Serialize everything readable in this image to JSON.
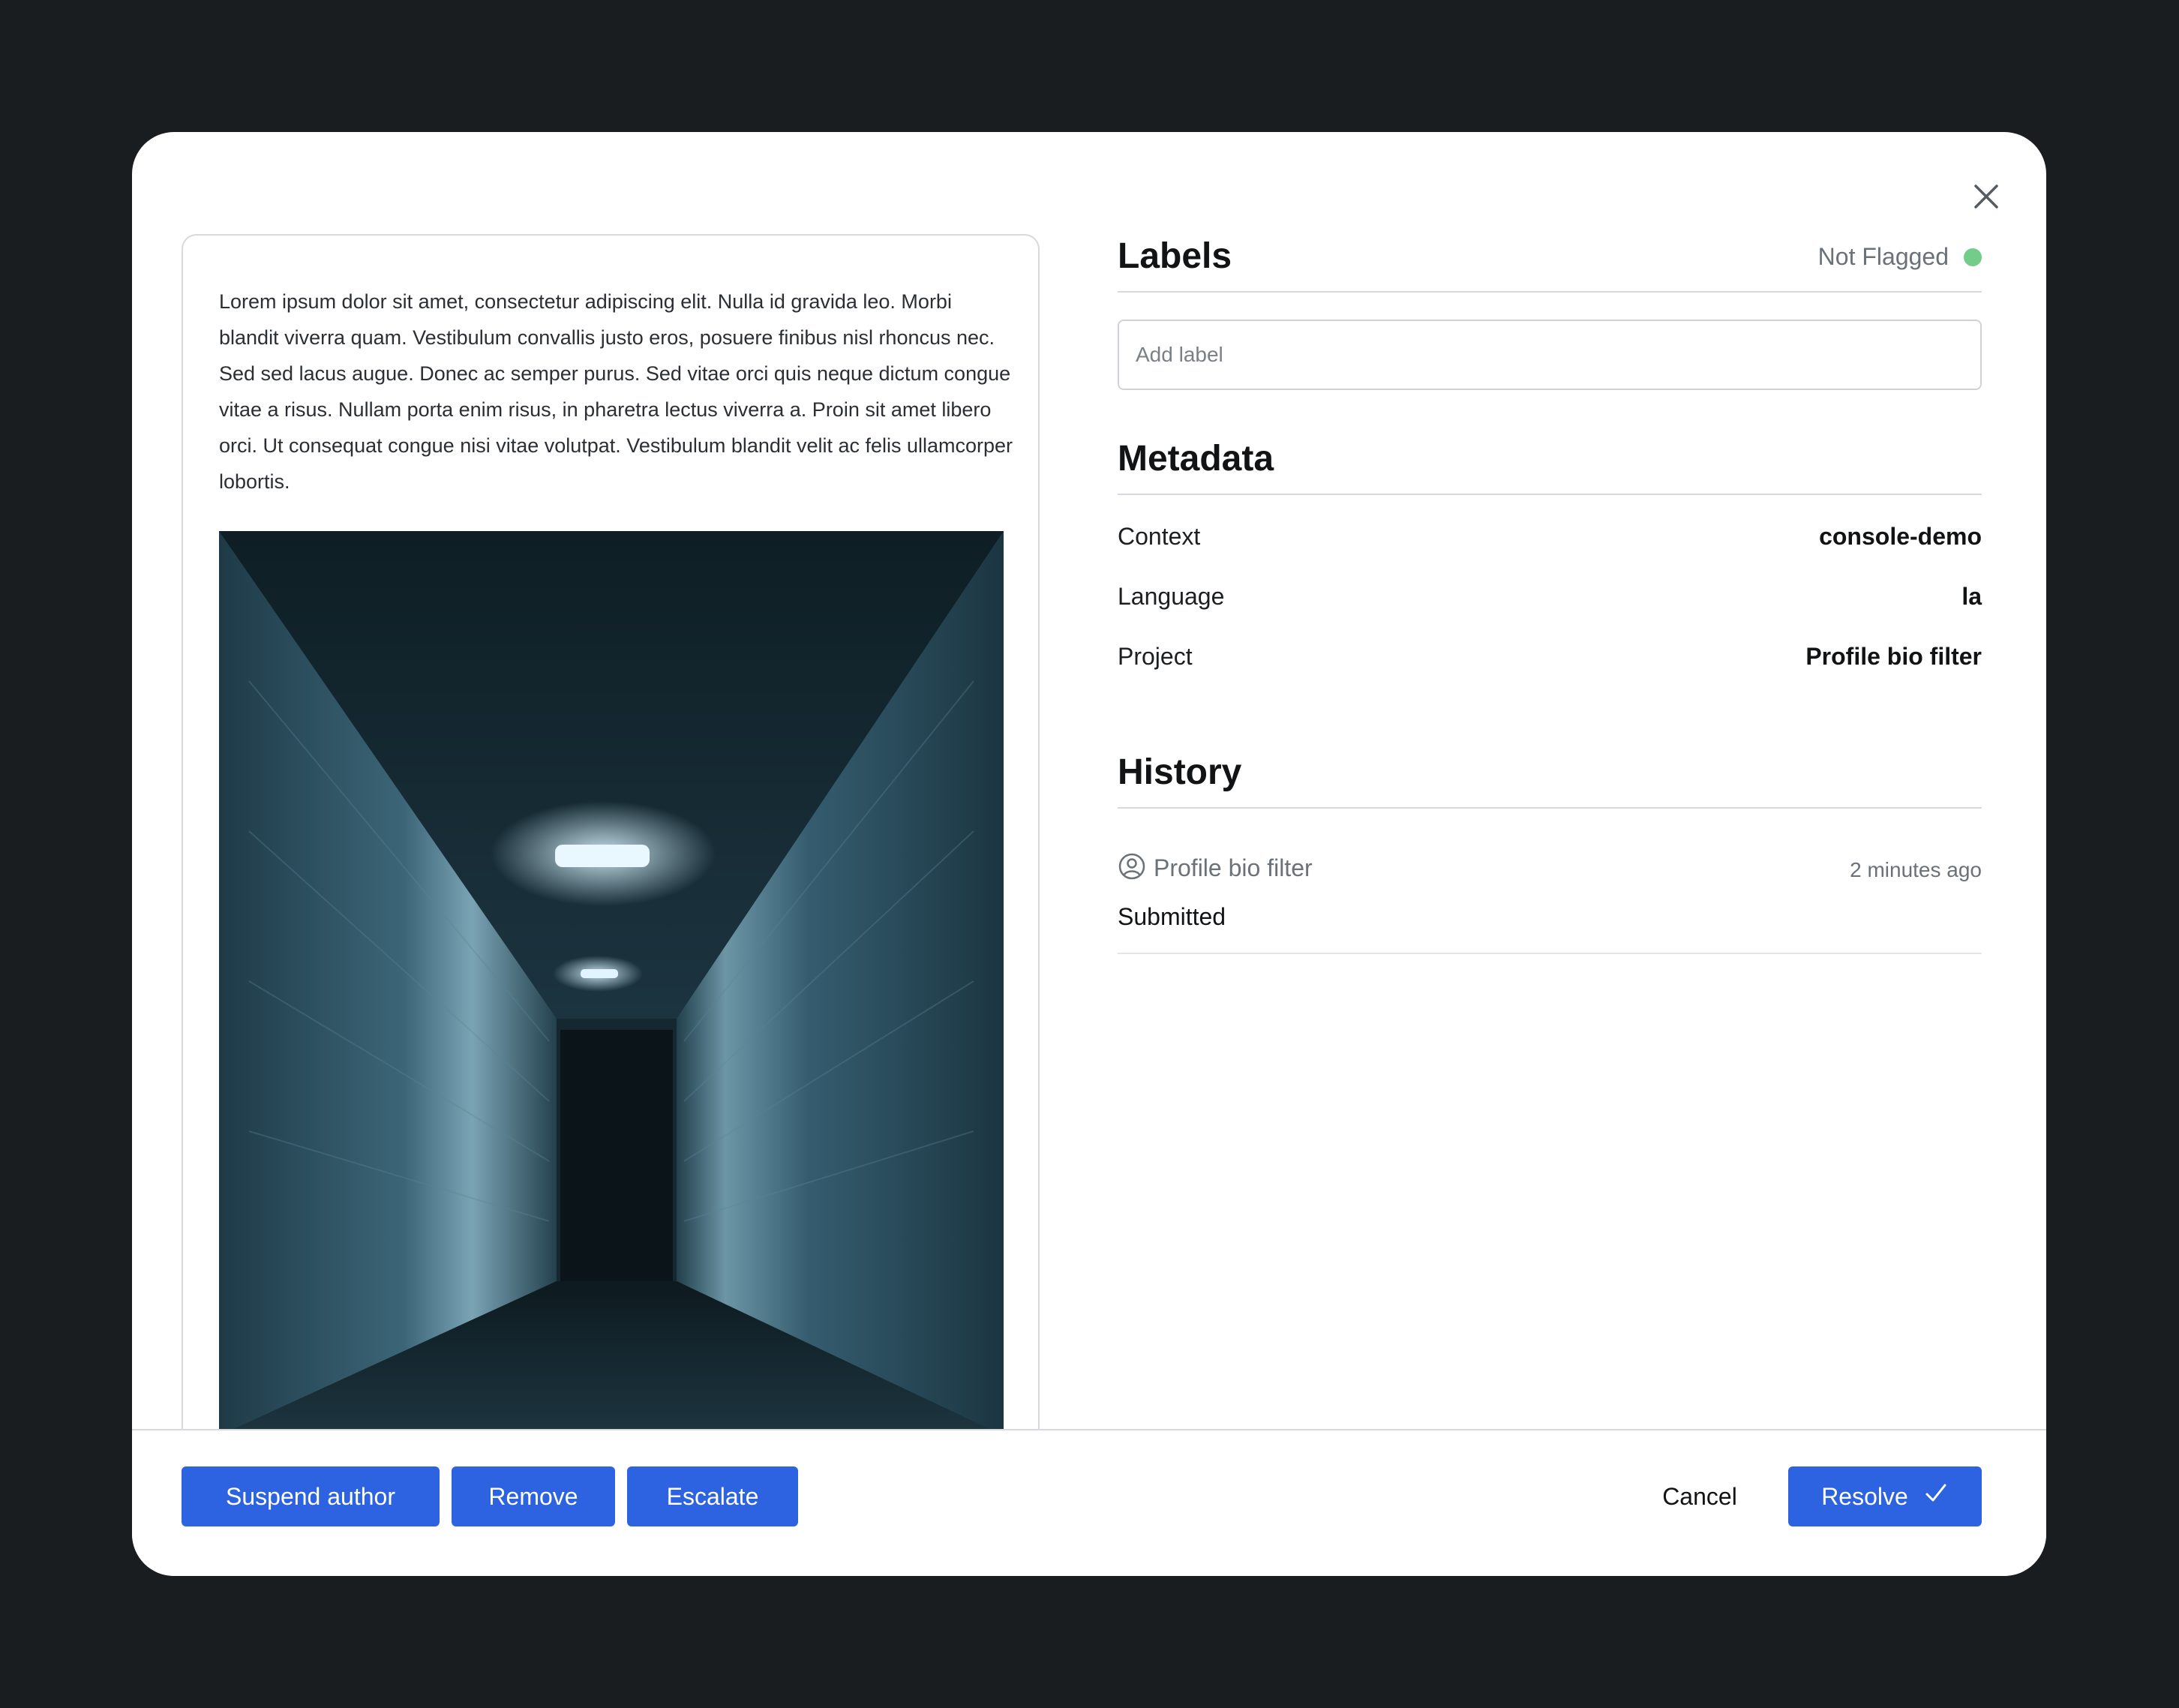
{
  "content": {
    "text": "Lorem ipsum dolor sit amet, consectetur adipiscing elit. Nulla id gravida leo. Morbi blandit viverra quam. Vestibulum convallis justo eros, posuere finibus nisl rhoncus nec. Sed sed lacus augue. Donec ac semper purus. Sed vitae orci quis neque dictum congue vitae a risus. Nullam porta enim risus, in pharetra lectus viverra a. Proin sit amet libero orci. Ut consequat congue nisi vitae volutpat. Vestibulum blandit velit ac felis ullamcorper lobortis."
  },
  "labels": {
    "title": "Labels",
    "status": "Not Flagged",
    "status_color": "#74cc8a",
    "input_placeholder": "Add label"
  },
  "metadata": {
    "title": "Metadata",
    "rows": [
      {
        "key": "Context",
        "value": "console-demo"
      },
      {
        "key": "Language",
        "value": "la"
      },
      {
        "key": "Project",
        "value": "Profile bio filter"
      }
    ]
  },
  "history": {
    "title": "History",
    "entries": [
      {
        "user": "Profile bio filter",
        "time": "2 minutes ago",
        "action": "Submitted"
      }
    ]
  },
  "footer": {
    "suspend_label": "Suspend author",
    "remove_label": "Remove",
    "escalate_label": "Escalate",
    "cancel_label": "Cancel",
    "resolve_label": "Resolve"
  },
  "colors": {
    "accent": "#2d63e0",
    "backdrop": "#1a1d20"
  },
  "icons": {
    "close": "close-icon",
    "user": "user-circle-icon",
    "check": "check-icon"
  }
}
